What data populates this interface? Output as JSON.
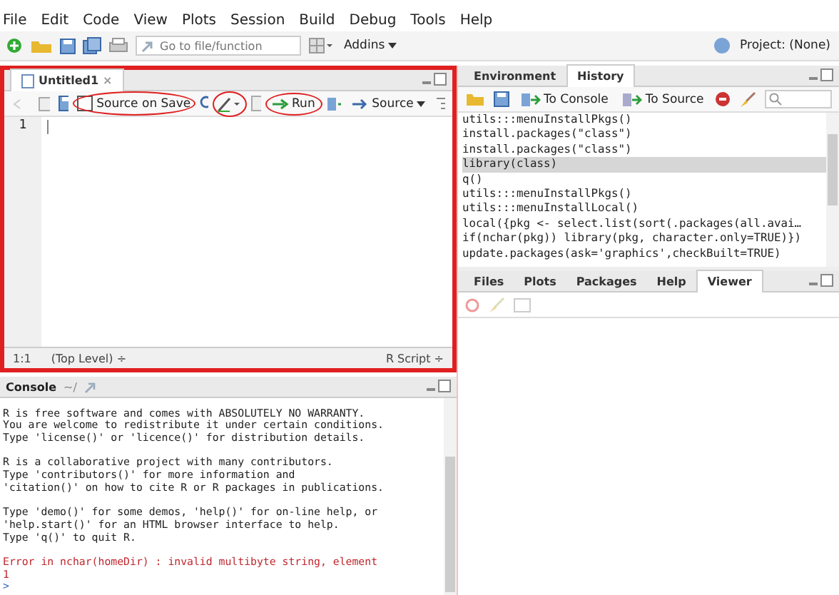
{
  "menu": [
    "File",
    "Edit",
    "Code",
    "View",
    "Plots",
    "Session",
    "Build",
    "Debug",
    "Tools",
    "Help"
  ],
  "toolbar": {
    "goto_placeholder": "Go to file/function",
    "addins": "Addins",
    "project": "Project: (None)"
  },
  "source": {
    "tab": "Untitled1",
    "close": "×",
    "source_on_save": {
      "label": "Source on Save",
      "checked": false
    },
    "run": "Run",
    "source": "Source",
    "line_numbers": [
      "1"
    ],
    "position": "1:1",
    "scope": "(Top Level) ÷",
    "file_type": "R Script ÷"
  },
  "env_pane": {
    "tabs": [
      {
        "label": "Environment",
        "selected": false
      },
      {
        "label": "History",
        "selected": true
      }
    ],
    "to_console": "To Console",
    "to_source": "To Source",
    "history": [
      {
        "text": "utils:::menuInstallPkgs()",
        "selected": false
      },
      {
        "text": "install.packages(\"class\")",
        "selected": false
      },
      {
        "text": "install.packages(\"class\")",
        "selected": false
      },
      {
        "text": "library(class)",
        "selected": true
      },
      {
        "text": "q()",
        "selected": false
      },
      {
        "text": "utils:::menuInstallPkgs()",
        "selected": false
      },
      {
        "text": "utils:::menuInstallLocal()",
        "selected": false
      },
      {
        "text": "local({pkg <- select.list(sort(.packages(all.avai…",
        "selected": false
      },
      {
        "text": "if(nchar(pkg)) library(pkg, character.only=TRUE)})",
        "selected": false
      },
      {
        "text": "update.packages(ask='graphics',checkBuilt=TRUE)",
        "selected": false
      }
    ]
  },
  "files_pane": {
    "tabs": [
      {
        "label": "Files",
        "selected": false
      },
      {
        "label": "Plots",
        "selected": false
      },
      {
        "label": "Packages",
        "selected": false
      },
      {
        "label": "Help",
        "selected": false
      },
      {
        "label": "Viewer",
        "selected": true
      }
    ]
  },
  "console": {
    "title": "Console",
    "path": "~/",
    "lines": [
      {
        "kind": "normal",
        "text": "R is free software and comes with ABSOLUTELY NO WARRANTY."
      },
      {
        "kind": "normal",
        "text": "You are welcome to redistribute it under certain conditions."
      },
      {
        "kind": "normal",
        "text": "Type 'license()' or 'licence()' for distribution details."
      },
      {
        "kind": "blank"
      },
      {
        "kind": "normal",
        "text": "R is a collaborative project with many contributors."
      },
      {
        "kind": "normal",
        "text": "Type 'contributors()' for more information and"
      },
      {
        "kind": "normal",
        "text": "'citation()' on how to cite R or R packages in publications."
      },
      {
        "kind": "blank"
      },
      {
        "kind": "normal",
        "text": "Type 'demo()' for some demos, 'help()' for on-line help, or"
      },
      {
        "kind": "normal",
        "text": "'help.start()' for an HTML browser interface to help."
      },
      {
        "kind": "normal",
        "text": "Type 'q()' to quit R."
      },
      {
        "kind": "blank"
      },
      {
        "kind": "error",
        "text": "Error in nchar(homeDir) : invalid multibyte string, element"
      },
      {
        "kind": "error",
        "text": "1"
      }
    ],
    "prompt": ">"
  }
}
